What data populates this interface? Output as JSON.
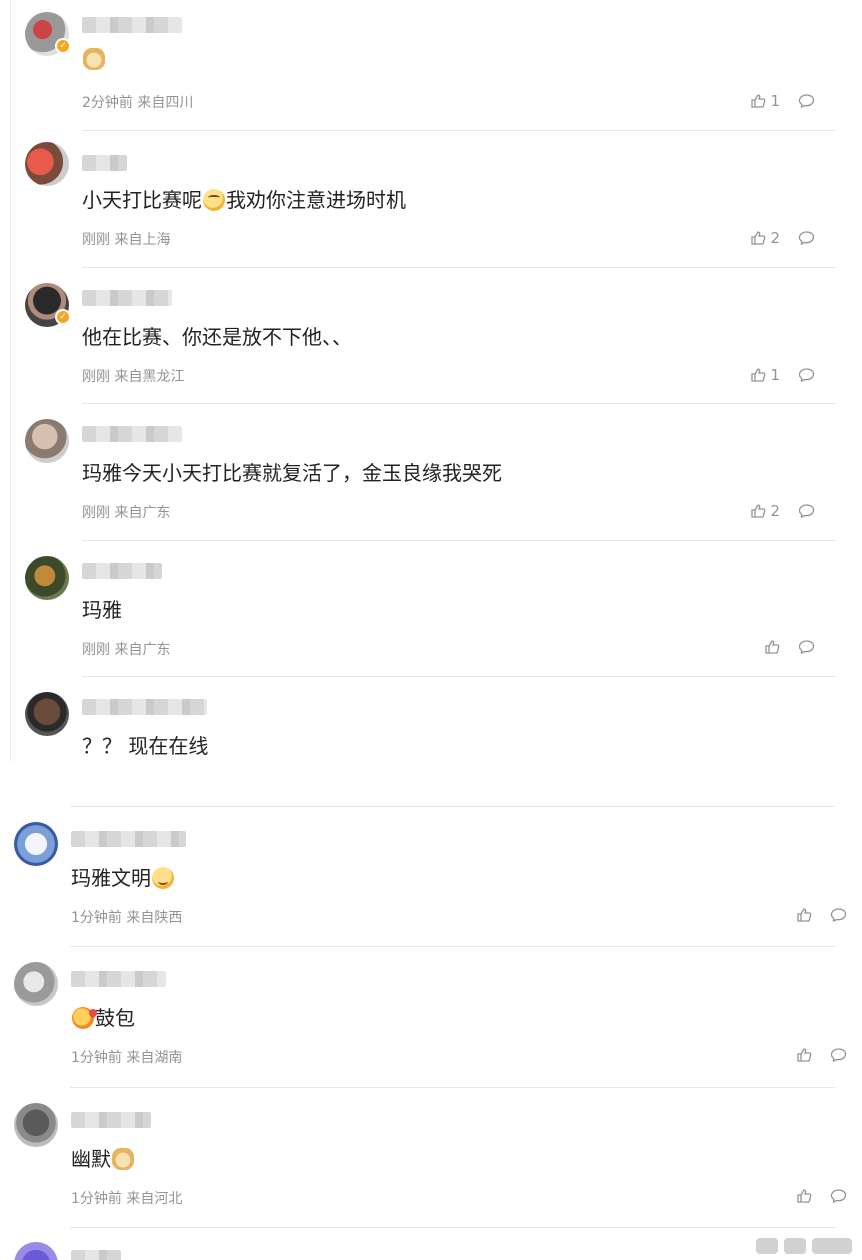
{
  "comments_block_1": [
    {
      "username": "",
      "text": "",
      "emoji": "doge",
      "time": "2分钟前",
      "location": "来自四川",
      "likes": "1",
      "verified": true
    },
    {
      "username": "",
      "text_before": "小天打比赛呢",
      "emoji": "sweat",
      "text_after": "我劝你注意进场时机",
      "time": "刚刚",
      "location": "来自上海",
      "likes": "2",
      "verified": false
    },
    {
      "username": "",
      "text": "他在比赛、你还是放不下他、、",
      "time": "刚刚",
      "location": "来自黑龙江",
      "likes": "1",
      "verified": true
    },
    {
      "username": "",
      "text": "玛雅今天小天打比赛就复活了，金玉良缘我哭死",
      "time": "刚刚",
      "location": "来自广东",
      "likes": "2",
      "verified": false
    },
    {
      "username": "",
      "text": "玛雅",
      "time": "刚刚",
      "location": "来自广东",
      "likes": "",
      "verified": false
    },
    {
      "username": "",
      "text": "？？ 现在在线",
      "verified": false
    }
  ],
  "comments_block_2": [
    {
      "username": "",
      "text": "玛雅文明",
      "emoji": "smile",
      "time": "1分钟前",
      "location": "来自陕西",
      "likes": ""
    },
    {
      "username": "",
      "text": "鼓包",
      "emoji": "kiss",
      "time": "1分钟前",
      "location": "来自湖南",
      "likes": ""
    },
    {
      "username": "",
      "text": "幽默",
      "emoji": "doge",
      "time": "1分钟前",
      "location": "来自河北",
      "likes": ""
    }
  ],
  "icons": {
    "like": "thumbs-up-icon",
    "comment": "comment-bubble-icon",
    "verified": "verified-badge-icon"
  },
  "colors": {
    "meta": "#939393",
    "verified": "#f5a623",
    "divider": "#e6e6e6"
  }
}
